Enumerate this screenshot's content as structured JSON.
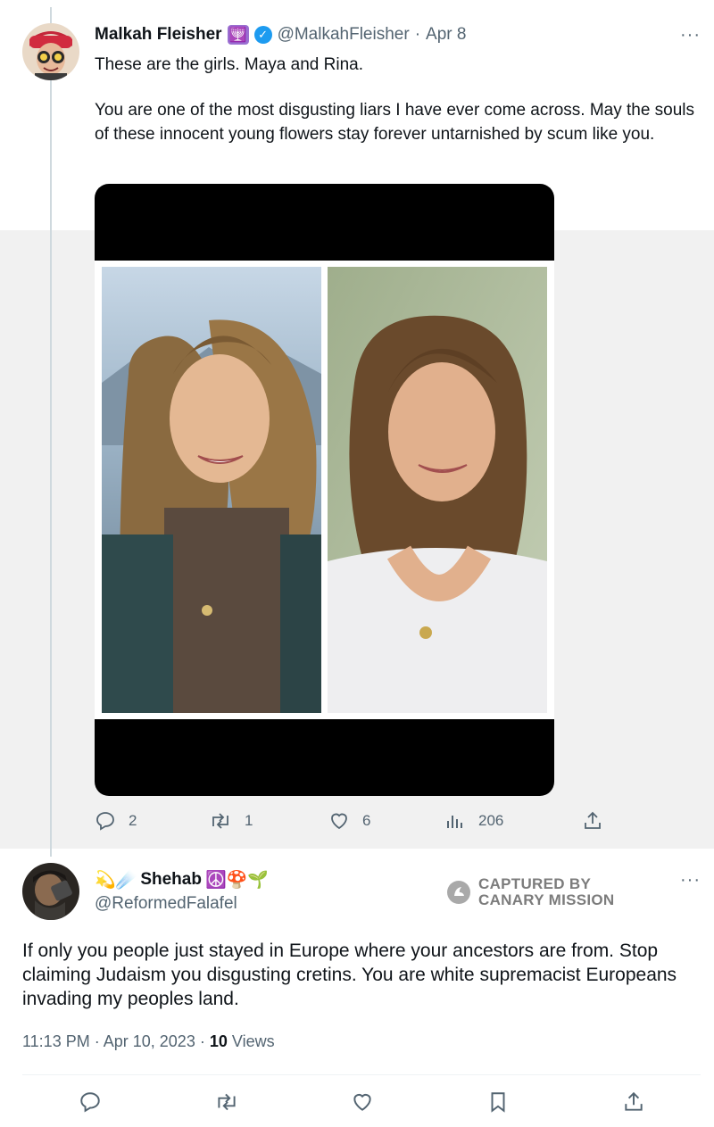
{
  "tweet1": {
    "name": "Malkah Fleisher",
    "emoji": "🕎",
    "handle": "@MalkahFleisher",
    "date": "Apr 8",
    "sep": "·",
    "more": "···",
    "line1": "These are the girls. Maya and Rina.",
    "line2": "You are one of the most disgusting liars I have ever come across. May the souls of these innocent young flowers stay forever untarnished by scum like you.",
    "actions": {
      "replies": "2",
      "reposts": "1",
      "likes": "6",
      "views": "206"
    }
  },
  "tweet2": {
    "name_prefix": "💫☄️",
    "name": "Shehab",
    "name_suffix": "☮️🍄🌱",
    "handle": "@ReformedFalafel",
    "more": "···",
    "text": "If only you people just stayed in Europe where your ancestors are from. Stop claiming Judaism you disgusting cretins. You are white supremacist Europeans invading my peoples land.",
    "time": "11:13 PM",
    "date": "Apr 10, 2023",
    "sep": "·",
    "views_count": "10",
    "views_label": "Views"
  },
  "watermark": {
    "line1": "CAPTURED BY",
    "line2": "CANARY MISSION"
  },
  "icons": {
    "reply": "reply-icon",
    "repost": "repost-icon",
    "like": "heart-icon",
    "views": "views-icon",
    "share": "share-icon",
    "bookmark": "bookmark-icon"
  },
  "colors": {
    "verified": "#1d9bf0",
    "secondary_text": "#536471",
    "primary_text": "#0f1419"
  }
}
